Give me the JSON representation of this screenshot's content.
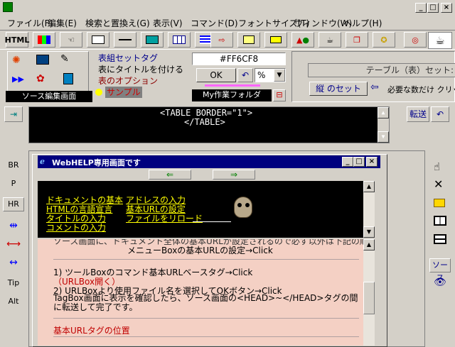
{
  "menu": [
    "ファイル(F)",
    "編集(E)",
    "検索と置換え(G)",
    "表示(V)",
    "コマンド(D)",
    "フォントサイズ(T)",
    "ウィンドウ(W)",
    "ヘルプ(H)"
  ],
  "toolbar": {
    "html_label": "HTML"
  },
  "tags_panel": {
    "items": [
      "表組セットタグ",
      "表にタイトルを付ける",
      "表のオプション",
      "サンプル"
    ],
    "source_label": "ソース編集画面"
  },
  "color_panel": {
    "hex_value": "#FF6CF8",
    "ok_label": "OK",
    "percent_label": "%",
    "folder_label": "My作業フォルダ"
  },
  "table_panel": {
    "title": "テーブル（表）セット:",
    "set_button": "縦 のセット",
    "hint": "必要な数だけ クリッ"
  },
  "editor": {
    "line1": "<TABLE BORDER=\"1\">",
    "line2": "</TABLE>",
    "transfer_label": "転送"
  },
  "left_side": [
    "BR",
    "P",
    "HR",
    "Tip",
    "Alt"
  ],
  "right_side": {
    "source_label": "ソース"
  },
  "help_window": {
    "title": "WebHELP専用画面です",
    "links": [
      "ドキュメントの基本",
      "HTMLの言語宣言",
      "タイトルの入力",
      "コメントの入力",
      "アドレスの入力",
      "基本URLの設定",
      "ファイルをリロード"
    ],
    "content": {
      "partial_top": "ソース画面に、ドキュメント全体の基本URLが設定されるので必ず以外は下記の順に操作します。",
      "menu_line": "メニューBoxの基本URLの設定→Click",
      "step1": "1) ツールBoxのコマンド基本URLベースタグ→Click",
      "step1_link": "（URLBox開く）",
      "step2": "2) URLBoxより使用ファイル名を選択してOKボタン→Click",
      "step3": "TagBox画面に表示を確認したら、ソース画面の<HEAD>~</HEAD>タグの間に転送して完了です。",
      "heading": "基本URLタグの位置"
    }
  }
}
